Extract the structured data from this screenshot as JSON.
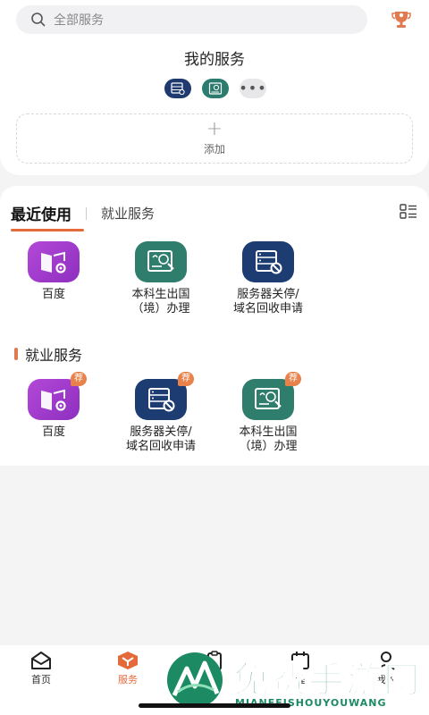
{
  "search": {
    "placeholder": "全部服务"
  },
  "my_services": {
    "title": "我的服务",
    "more_icon": "•••",
    "add_label": "添加"
  },
  "tabs": {
    "active": "最近使用",
    "inactive": "就业服务"
  },
  "recent": [
    {
      "label": "百度",
      "icon": "book-gear-icon",
      "color": "#a23dcf"
    },
    {
      "label": "本科生出国\n（境）办理",
      "icon": "certificate-icon",
      "color": "#2f7d6d"
    },
    {
      "label": "服务器关停/\n域名回收申请",
      "icon": "server-block-icon",
      "color": "#1d3c72"
    }
  ],
  "employment": {
    "title": "就业服务",
    "badge": "荐",
    "items": [
      {
        "label": "百度",
        "icon": "book-gear-icon",
        "color": "#a23dcf"
      },
      {
        "label": "服务器关停/\n域名回收申请",
        "icon": "server-block-icon",
        "color": "#1d3c72"
      },
      {
        "label": "本科生出国\n（境）办理",
        "icon": "certificate-icon",
        "color": "#2f7d6d"
      }
    ]
  },
  "nav": {
    "home": "首页",
    "services": "服务",
    "schedule": "程",
    "me": "我的"
  },
  "watermark": {
    "title": "免费手游网",
    "subtitle": "MIANFEISHOUYOUWANG"
  },
  "colors": {
    "accent": "#e46a3a",
    "purple": "#a23dcf",
    "teal": "#2f7d6d",
    "navy": "#1d3c72"
  }
}
